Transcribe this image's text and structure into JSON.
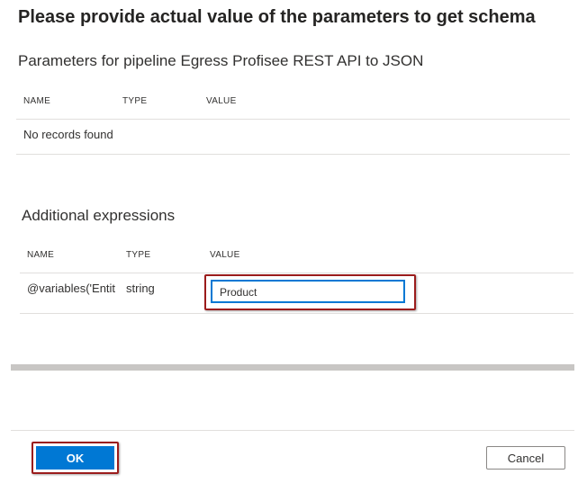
{
  "dialog": {
    "title": "Please provide actual value of the parameters to get schema"
  },
  "parameters_section": {
    "title": "Parameters for pipeline Egress Profisee REST API to JSON",
    "columns": [
      "NAME",
      "TYPE",
      "VALUE"
    ],
    "empty_message": "No records found"
  },
  "expressions_section": {
    "title": "Additional expressions",
    "columns": [
      "NAME",
      "TYPE",
      "VALUE"
    ],
    "rows": [
      {
        "name": "@variables('Entit",
        "type": "string",
        "value": "Product"
      }
    ]
  },
  "footer": {
    "ok_label": "OK",
    "cancel_label": "Cancel"
  },
  "colors": {
    "primary": "#0078d4",
    "callout": "#9b1c1c"
  }
}
